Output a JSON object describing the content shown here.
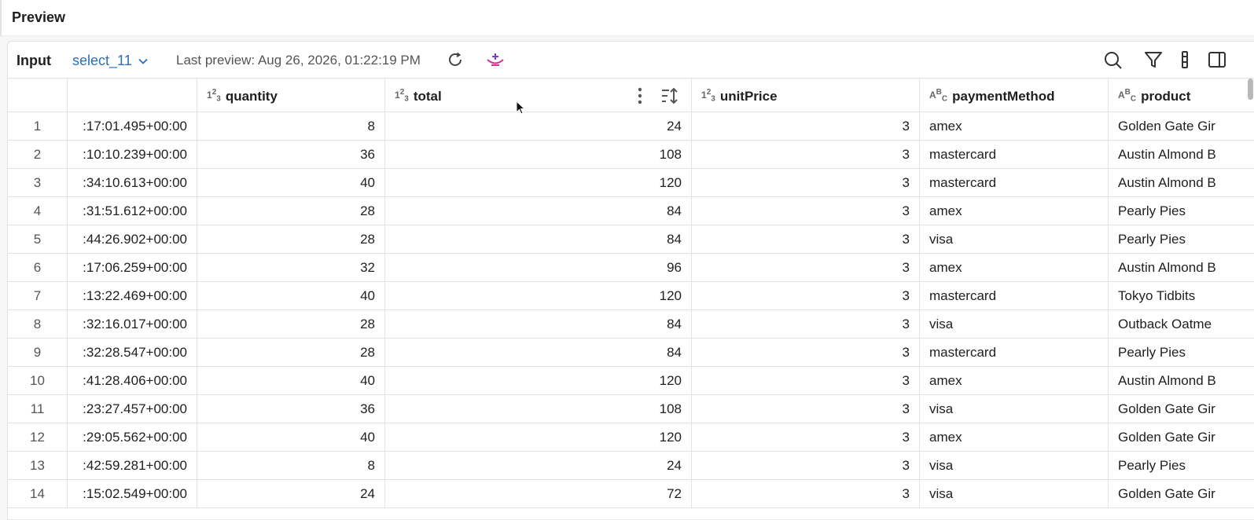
{
  "header": {
    "title": "Preview"
  },
  "toolbar": {
    "input_label": "Input",
    "selected_source": "select_11",
    "last_preview": "Last preview: Aug 26, 2026, 01:22:19 PM",
    "icons": [
      "refresh-icon",
      "genie-icon",
      "search-icon",
      "filter-icon",
      "columns-icon",
      "panel-icon"
    ]
  },
  "table": {
    "columns": [
      {
        "name": "",
        "type": "index"
      },
      {
        "name": "",
        "type": "timestamp"
      },
      {
        "name": "quantity",
        "type": "123"
      },
      {
        "name": "total",
        "type": "123"
      },
      {
        "name": "unitPrice",
        "type": "123"
      },
      {
        "name": "paymentMethod",
        "type": "ABC"
      },
      {
        "name": "product",
        "type": "ABC"
      }
    ],
    "rows": [
      {
        "i": "1",
        "ts": ":17:01.495+00:00",
        "quantity": "8",
        "total": "24",
        "unitPrice": "3",
        "paymentMethod": "amex",
        "product": "Golden Gate Gir"
      },
      {
        "i": "2",
        "ts": ":10:10.239+00:00",
        "quantity": "36",
        "total": "108",
        "unitPrice": "3",
        "paymentMethod": "mastercard",
        "product": "Austin Almond B"
      },
      {
        "i": "3",
        "ts": ":34:10.613+00:00",
        "quantity": "40",
        "total": "120",
        "unitPrice": "3",
        "paymentMethod": "mastercard",
        "product": "Austin Almond B"
      },
      {
        "i": "4",
        "ts": ":31:51.612+00:00",
        "quantity": "28",
        "total": "84",
        "unitPrice": "3",
        "paymentMethod": "amex",
        "product": "Pearly Pies"
      },
      {
        "i": "5",
        "ts": ":44:26.902+00:00",
        "quantity": "28",
        "total": "84",
        "unitPrice": "3",
        "paymentMethod": "visa",
        "product": "Pearly Pies"
      },
      {
        "i": "6",
        "ts": ":17:06.259+00:00",
        "quantity": "32",
        "total": "96",
        "unitPrice": "3",
        "paymentMethod": "amex",
        "product": "Austin Almond B"
      },
      {
        "i": "7",
        "ts": ":13:22.469+00:00",
        "quantity": "40",
        "total": "120",
        "unitPrice": "3",
        "paymentMethod": "mastercard",
        "product": "Tokyo Tidbits"
      },
      {
        "i": "8",
        "ts": ":32:16.017+00:00",
        "quantity": "28",
        "total": "84",
        "unitPrice": "3",
        "paymentMethod": "visa",
        "product": "Outback Oatme"
      },
      {
        "i": "9",
        "ts": ":32:28.547+00:00",
        "quantity": "28",
        "total": "84",
        "unitPrice": "3",
        "paymentMethod": "mastercard",
        "product": "Pearly Pies"
      },
      {
        "i": "10",
        "ts": ":41:28.406+00:00",
        "quantity": "40",
        "total": "120",
        "unitPrice": "3",
        "paymentMethod": "amex",
        "product": "Austin Almond B"
      },
      {
        "i": "11",
        "ts": ":23:27.457+00:00",
        "quantity": "36",
        "total": "108",
        "unitPrice": "3",
        "paymentMethod": "visa",
        "product": "Golden Gate Gir"
      },
      {
        "i": "12",
        "ts": ":29:05.562+00:00",
        "quantity": "40",
        "total": "120",
        "unitPrice": "3",
        "paymentMethod": "amex",
        "product": "Golden Gate Gir"
      },
      {
        "i": "13",
        "ts": ":42:59.281+00:00",
        "quantity": "8",
        "total": "24",
        "unitPrice": "3",
        "paymentMethod": "visa",
        "product": "Pearly Pies"
      },
      {
        "i": "14",
        "ts": ":15:02.549+00:00",
        "quantity": "24",
        "total": "72",
        "unitPrice": "3",
        "paymentMethod": "visa",
        "product": "Golden Gate Gir"
      }
    ]
  },
  "colors": {
    "accent": "#2b6fb9",
    "genie": "#d6338f"
  }
}
